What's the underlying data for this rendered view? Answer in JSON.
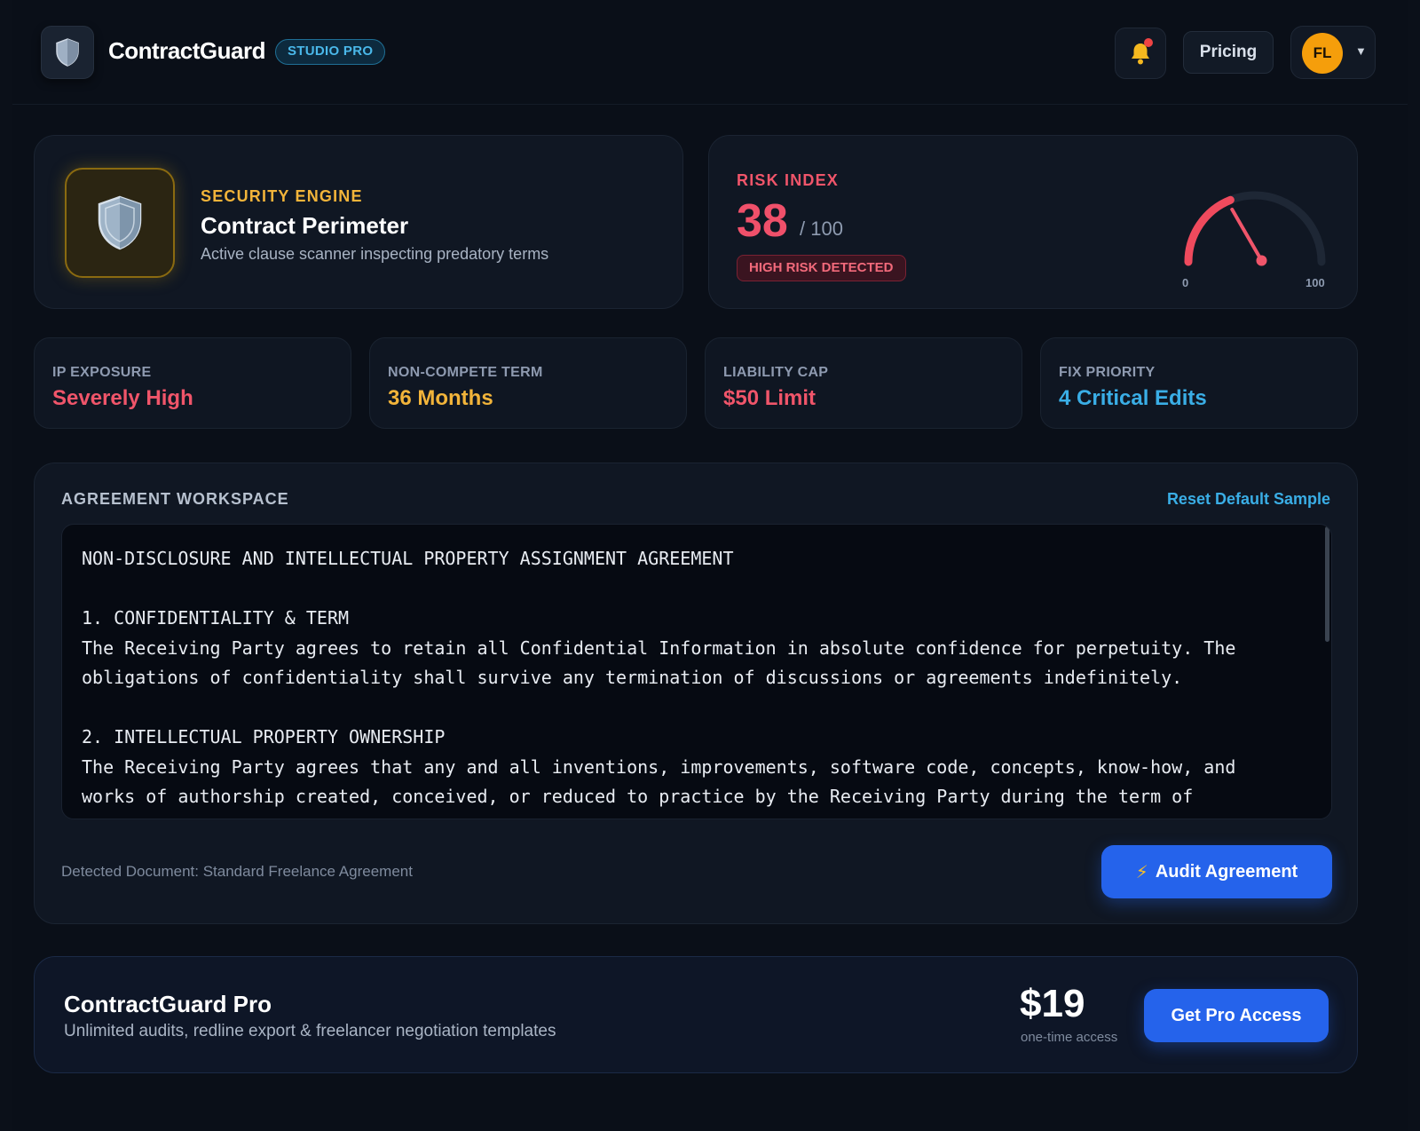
{
  "header": {
    "brand": "ContractGuard",
    "plan_badge": "STUDIO PRO",
    "pricing_label": "Pricing",
    "avatar_initials": "FL",
    "icons": {
      "logo": "shield-icon",
      "notifications": "bell-icon",
      "menu": "chevron-down-icon"
    }
  },
  "engine": {
    "eyebrow": "SECURITY ENGINE",
    "title": "Contract Perimeter",
    "subtitle": "Active clause scanner inspecting predatory terms"
  },
  "risk": {
    "eyebrow": "RISK INDEX",
    "score": "38",
    "max": "/ 100",
    "status": "HIGH RISK DETECTED",
    "gauge_value": 38,
    "gauge_min_label": "0",
    "gauge_max_label": "100"
  },
  "stats": [
    {
      "label": "IP EXPOSURE",
      "value": "Severely High",
      "color": "#f0556a"
    },
    {
      "label": "NON-COMPETE TERM",
      "value": "36 Months",
      "color": "#f2b43a"
    },
    {
      "label": "LIABILITY CAP",
      "value": "$50 Limit",
      "color": "#f0556a"
    },
    {
      "label": "FIX PRIORITY",
      "value": "4 Critical Edits",
      "color": "#3aaee6"
    }
  ],
  "workspace": {
    "title": "AGREEMENT WORKSPACE",
    "reset_label": "Reset Default Sample",
    "document_text": "NON-DISCLOSURE AND INTELLECTUAL PROPERTY ASSIGNMENT AGREEMENT\n\n1. CONFIDENTIALITY & TERM\nThe Receiving Party agrees to retain all Confidential Information in absolute confidence for perpetuity. The obligations of confidentiality shall survive any termination of discussions or agreements indefinitely.\n\n2. INTELLECTUAL PROPERTY OWNERSHIP\nThe Receiving Party agrees that any and all inventions, improvements, software code, concepts, know-how, and works of authorship created, conceived, or reduced to practice by the Receiving Party during the term of",
    "detected": "Detected Document: Standard Freelance Agreement",
    "audit_label": "Audit Agreement"
  },
  "pro": {
    "title": "ContractGuard Pro",
    "subtitle": "Unlimited audits, redline export & freelancer negotiation templates",
    "price": "$19",
    "price_note": "one-time access",
    "cta": "Get Pro Access"
  },
  "colors": {
    "accent": "#2563eb",
    "danger": "#f0556a",
    "warning": "#f2b43a",
    "info": "#3aaee6"
  }
}
